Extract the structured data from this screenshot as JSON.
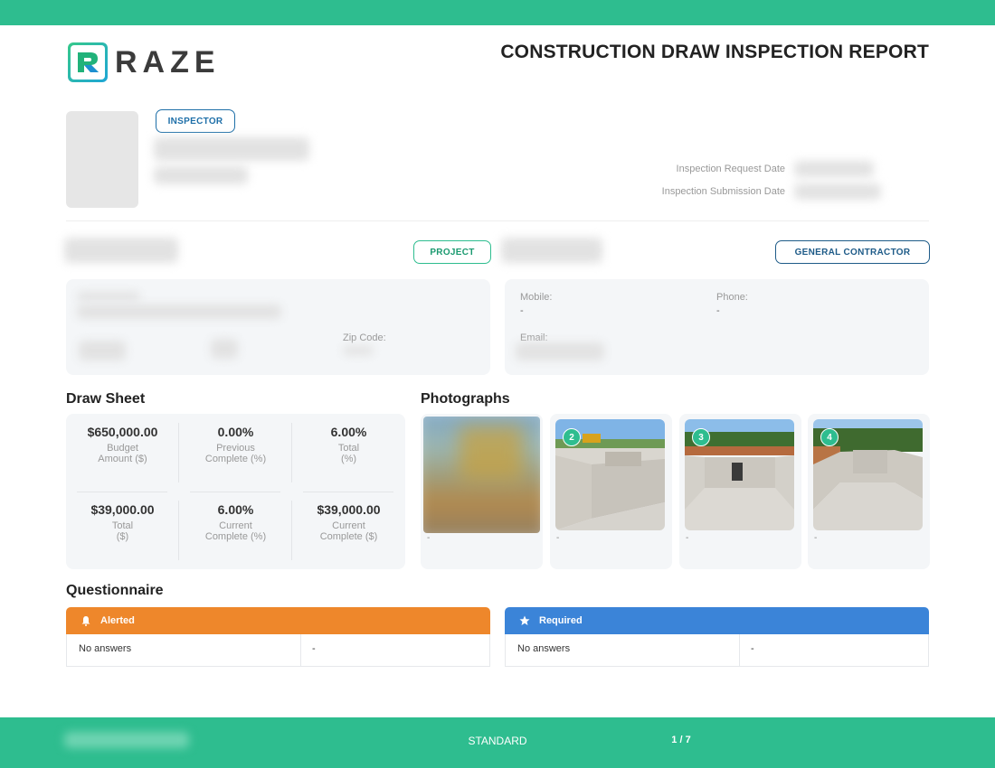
{
  "header": {
    "logo_text": "RAZE",
    "report_title": "CONSTRUCTION DRAW INSPECTION REPORT"
  },
  "inspector": {
    "badge": "INSPECTOR",
    "request_date_label": "Inspection Request Date",
    "submission_date_label": "Inspection Submission Date"
  },
  "project": {
    "badge": "PROJECT",
    "zip_label": "Zip Code:"
  },
  "general_contractor": {
    "badge": "GENERAL CONTRACTOR",
    "mobile_label": "Mobile:",
    "mobile_value": "-",
    "phone_label": "Phone:",
    "phone_value": "-",
    "email_label": "Email:"
  },
  "draw_sheet": {
    "title": "Draw Sheet",
    "metrics": [
      {
        "value": "$650,000.00",
        "label_1": "Budget",
        "label_2": "Amount ($)"
      },
      {
        "value": "0.00%",
        "label_1": "Previous",
        "label_2": "Complete (%)"
      },
      {
        "value": "6.00%",
        "label_1": "Total",
        "label_2": "(%)"
      },
      {
        "value": "$39,000.00",
        "label_1": "Total",
        "label_2": "($)"
      },
      {
        "value": "6.00%",
        "label_1": "Current",
        "label_2": "Complete (%)"
      },
      {
        "value": "$39,000.00",
        "label_1": "Current",
        "label_2": "Complete ($)"
      }
    ]
  },
  "photographs": {
    "title": "Photographs",
    "items": [
      {
        "badge": "",
        "caption": "-"
      },
      {
        "badge": "2",
        "caption": "-"
      },
      {
        "badge": "3",
        "caption": "-"
      },
      {
        "badge": "4",
        "caption": "-"
      }
    ]
  },
  "questionnaire": {
    "title": "Questionnaire",
    "alerted": {
      "label": "Alerted",
      "answer": "No answers",
      "value": "-",
      "color": "#ee872b",
      "icon": "bell-icon"
    },
    "required": {
      "label": "Required",
      "answer": "No answers",
      "value": "-",
      "color": "#3b84d8",
      "icon": "star-icon"
    }
  },
  "footer": {
    "type": "STANDARD",
    "page": "1 / 7"
  },
  "colors": {
    "brand_green": "#2ebd8f",
    "inspector_blue": "#1e6fa8"
  }
}
